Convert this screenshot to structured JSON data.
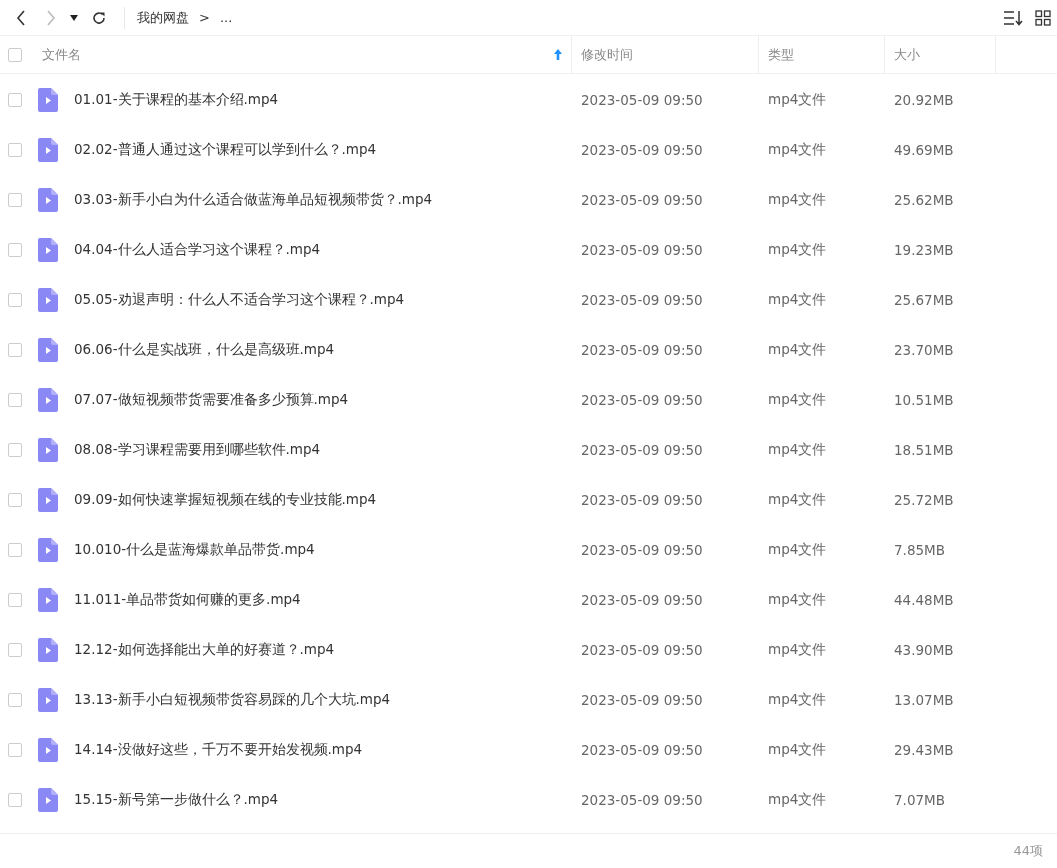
{
  "breadcrumb": {
    "root": "我的网盘",
    "separator": ">",
    "more": "..."
  },
  "table": {
    "select_all": {
      "checked": false
    },
    "columns": [
      {
        "label": "文件名",
        "sorted": true
      },
      {
        "label": "修改时间",
        "sorted": false
      },
      {
        "label": "类型",
        "sorted": false
      },
      {
        "label": "大小",
        "sorted": false
      }
    ],
    "rows": [
      {
        "name": "01.01-关于课程的基本介绍.mp4",
        "modified": "2023-05-09 09:50",
        "type": "mp4文件",
        "size": "20.92MB",
        "checked": false
      },
      {
        "name": "02.02-普通人通过这个课程可以学到什么？.mp4",
        "modified": "2023-05-09 09:50",
        "type": "mp4文件",
        "size": "49.69MB",
        "checked": false
      },
      {
        "name": "03.03-新手小白为什么适合做蓝海单品短视频带货？.mp4",
        "modified": "2023-05-09 09:50",
        "type": "mp4文件",
        "size": "25.62MB",
        "checked": false
      },
      {
        "name": "04.04-什么人适合学习这个课程？.mp4",
        "modified": "2023-05-09 09:50",
        "type": "mp4文件",
        "size": "19.23MB",
        "checked": false
      },
      {
        "name": "05.05-劝退声明：什么人不适合学习这个课程？.mp4",
        "modified": "2023-05-09 09:50",
        "type": "mp4文件",
        "size": "25.67MB",
        "checked": false
      },
      {
        "name": "06.06-什么是实战班，什么是高级班.mp4",
        "modified": "2023-05-09 09:50",
        "type": "mp4文件",
        "size": "23.70MB",
        "checked": false
      },
      {
        "name": "07.07-做短视频带货需要准备多少预算.mp4",
        "modified": "2023-05-09 09:50",
        "type": "mp4文件",
        "size": "10.51MB",
        "checked": false
      },
      {
        "name": "08.08-学习课程需要用到哪些软件.mp4",
        "modified": "2023-05-09 09:50",
        "type": "mp4文件",
        "size": "18.51MB",
        "checked": false
      },
      {
        "name": "09.09-如何快速掌握短视频在线的专业技能.mp4",
        "modified": "2023-05-09 09:50",
        "type": "mp4文件",
        "size": "25.72MB",
        "checked": false
      },
      {
        "name": "10.010-什么是蓝海爆款单品带货.mp4",
        "modified": "2023-05-09 09:50",
        "type": "mp4文件",
        "size": "7.85MB",
        "checked": false
      },
      {
        "name": "11.011-单品带货如何赚的更多.mp4",
        "modified": "2023-05-09 09:50",
        "type": "mp4文件",
        "size": "44.48MB",
        "checked": false
      },
      {
        "name": "12.12-如何选择能出大单的好赛道？.mp4",
        "modified": "2023-05-09 09:50",
        "type": "mp4文件",
        "size": "43.90MB",
        "checked": false
      },
      {
        "name": "13.13-新手小白短视频带货容易踩的几个大坑.mp4",
        "modified": "2023-05-09 09:50",
        "type": "mp4文件",
        "size": "13.07MB",
        "checked": false
      },
      {
        "name": "14.14-没做好这些，千万不要开始发视频.mp4",
        "modified": "2023-05-09 09:50",
        "type": "mp4文件",
        "size": "29.43MB",
        "checked": false
      },
      {
        "name": "15.15-新号第一步做什么？.mp4",
        "modified": "2023-05-09 09:50",
        "type": "mp4文件",
        "size": "7.07MB",
        "checked": false
      }
    ]
  },
  "status_bar": {
    "count": "44项"
  }
}
